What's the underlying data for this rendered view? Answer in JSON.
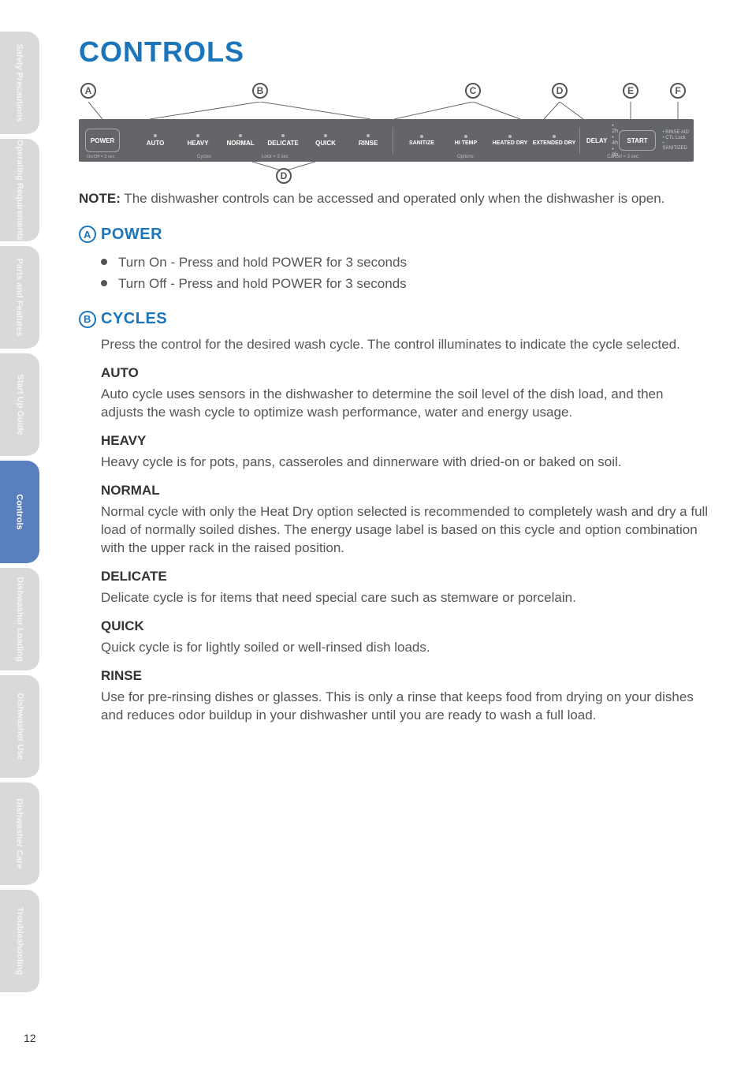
{
  "sidebar": {
    "tabs": [
      {
        "label": "Safety Precautions"
      },
      {
        "label": "Operating Requirements"
      },
      {
        "label": "Parts and Features"
      },
      {
        "label": "Start Up Guide"
      },
      {
        "label": "Controls"
      },
      {
        "label": "Dishwasher Loading"
      },
      {
        "label": "Dishwasher Use"
      },
      {
        "label": "Dishwasher Care"
      },
      {
        "label": "Troubleshooting"
      }
    ],
    "active_index": 4
  },
  "page_number": "12",
  "title": "CONTROLS",
  "diagram": {
    "callouts": [
      "A",
      "B",
      "C",
      "D",
      "E",
      "F"
    ],
    "bottom_callout": "D",
    "panel": {
      "power": "POWER",
      "power_sub": "On/Off = 3 sec",
      "cycles": [
        "AUTO",
        "HEAVY",
        "NORMAL",
        "DELICATE",
        "QUICK",
        "RINSE"
      ],
      "cycles_label": "Cycles",
      "lock_label": "Lock = 3 sec",
      "options": [
        "SANITIZE",
        "HI TEMP",
        "HEATED DRY",
        "EXTENDED DRY"
      ],
      "options_label": "Options",
      "delay": "DELAY",
      "delay_times": [
        "2h",
        "4h",
        "8h"
      ],
      "start": "START",
      "cancel_sub": "Cancel = 3 sec",
      "indicators": [
        "RINSE AID",
        "CTL Lock",
        "SANITIZED"
      ]
    }
  },
  "note_label": "NOTE:",
  "note_text": " The dishwasher controls can be accessed and operated only when the dishwasher is open.",
  "sections": {
    "power": {
      "letter": "A",
      "title": "POWER",
      "bullets": [
        "Turn On - Press and hold POWER for 3 seconds",
        "Turn Off - Press and hold POWER for 3 seconds"
      ]
    },
    "cycles": {
      "letter": "B",
      "title": "CYCLES",
      "intro": "Press the control for the desired wash cycle. The control illuminates to indicate the cycle selected.",
      "items": [
        {
          "name": "AUTO",
          "text": "Auto cycle uses sensors in the dishwasher to determine the soil level of the dish load, and then adjusts the wash cycle to optimize wash performance, water and energy usage."
        },
        {
          "name": "HEAVY",
          "text": "Heavy cycle is for pots, pans, casseroles and dinnerware with dried-on or baked on soil."
        },
        {
          "name": "NORMAL",
          "text": "Normal cycle with only the Heat Dry option selected is recommended to completely wash and dry a full load of normally soiled dishes. The energy usage label is based on this cycle and option combination with the upper rack in the raised position."
        },
        {
          "name": "DELICATE",
          "text": "Delicate cycle is for items that need special care such as stemware or porcelain."
        },
        {
          "name": "QUICK",
          "text": "Quick cycle is for lightly soiled or well-rinsed dish loads."
        },
        {
          "name": "RINSE",
          "text": "Use for pre-rinsing dishes or glasses. This is only a rinse that keeps food from drying on your dishes and reduces odor buildup in your dishwasher until you are ready to wash a full load."
        }
      ]
    }
  }
}
